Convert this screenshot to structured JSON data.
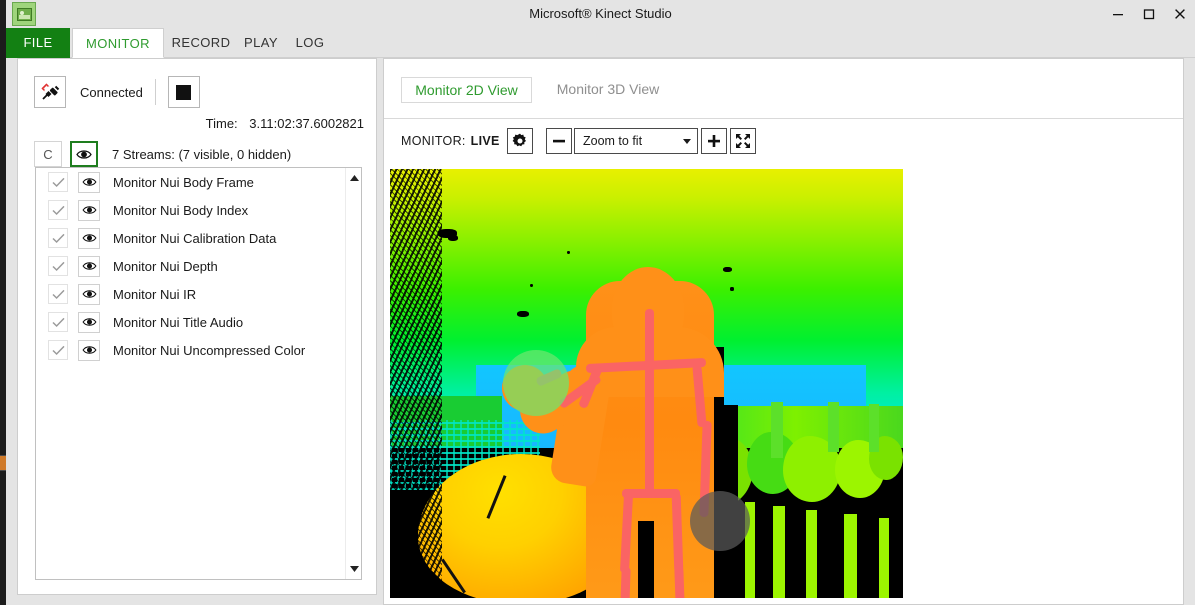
{
  "window": {
    "title": "Microsoft® Kinect Studio",
    "app_icon": "kinect-studio-icon",
    "minimize_label": "–",
    "maximize_label": "☐",
    "close_label": "✕"
  },
  "ribbon": {
    "tabs": [
      {
        "label": "FILE",
        "name": "tab-file",
        "selected": false
      },
      {
        "label": "MONITOR",
        "name": "tab-monitor",
        "selected": true
      },
      {
        "label": "RECORD",
        "name": "tab-record",
        "selected": false
      },
      {
        "label": "PLAY",
        "name": "tab-play",
        "selected": false
      },
      {
        "label": "LOG",
        "name": "tab-log",
        "selected": false
      }
    ]
  },
  "left_panel": {
    "connection": {
      "icon": "plug-connected-icon",
      "status_label": "Connected",
      "stop_button_icon": "stop-square-icon"
    },
    "time": {
      "label": "Time:",
      "value": "3.11:02:37.6002821"
    },
    "streams_header": {
      "clear_button_label": "C",
      "eye_button_icon": "eye-icon",
      "summary": "7 Streams: (7 visible, 0 hidden)"
    },
    "streams": [
      {
        "name": "Monitor Nui Body Frame",
        "checked": true,
        "visible": true
      },
      {
        "name": "Monitor Nui Body Index",
        "checked": true,
        "visible": true
      },
      {
        "name": "Monitor Nui Calibration Data",
        "checked": true,
        "visible": true
      },
      {
        "name": "Monitor Nui Depth",
        "checked": true,
        "visible": true
      },
      {
        "name": "Monitor Nui IR",
        "checked": true,
        "visible": true
      },
      {
        "name": "Monitor Nui Title Audio",
        "checked": true,
        "visible": true
      },
      {
        "name": "Monitor Nui Uncompressed Color",
        "checked": true,
        "visible": true
      }
    ],
    "scrollbar": {
      "up_arrow": "▲",
      "down_arrow": "▼"
    }
  },
  "right_panel": {
    "view_tabs": [
      {
        "label": "Monitor 2D View",
        "name": "tab-monitor-2d-view",
        "selected": true
      },
      {
        "label": "Monitor 3D View",
        "name": "tab-monitor-3d-view",
        "selected": false
      }
    ],
    "toolbar": {
      "mode_label": "MONITOR:",
      "mode_value": "LIVE",
      "settings_icon": "gear-icon",
      "zoom_out_icon": "minus-icon",
      "zoom_value": "Zoom to fit",
      "zoom_in_icon": "plus-icon",
      "fullscreen_icon": "expand-arrows-icon"
    },
    "viewport": {
      "content_description": "Kinect depth stream with body skeleton overlay",
      "hand_left_state_color": "#6ee66e",
      "hand_right_state_color": "#5a5a5a",
      "skeleton_color": "#fa6464",
      "body_index_color": "#ff9018"
    }
  },
  "colors": {
    "accent_green": "#138013",
    "tab_text_green": "#2f9b2f",
    "file_tab_bg": "#138013",
    "window_bg": "#e4e4e4",
    "panel_bg": "#ffffff"
  }
}
